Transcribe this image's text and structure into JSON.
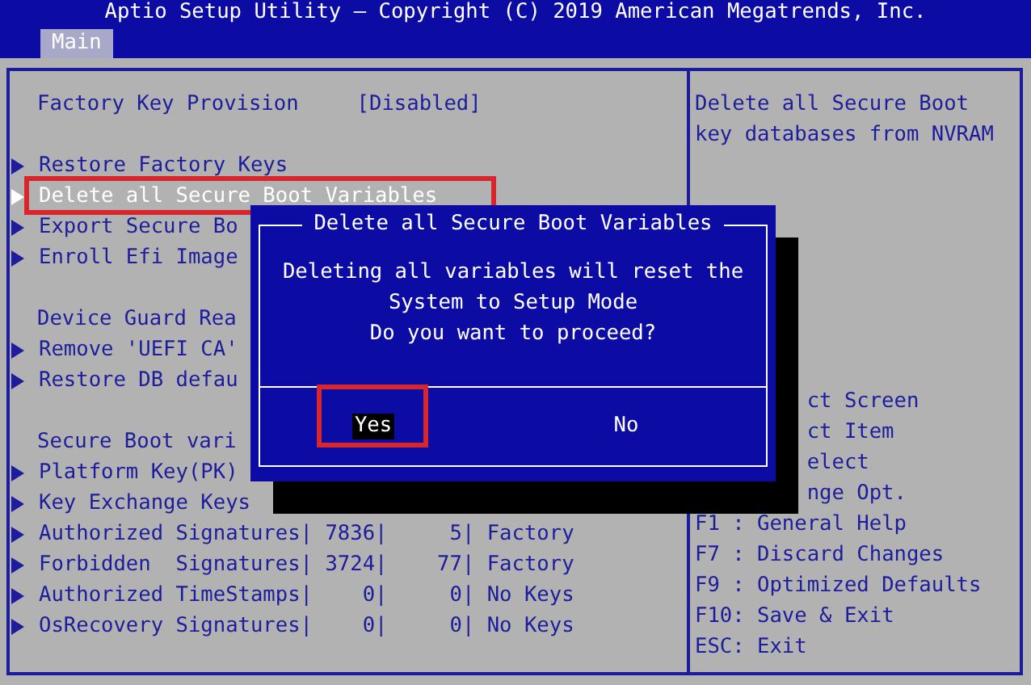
{
  "window": {
    "title": "Aptio Setup Utility – Copyright (C) 2019 American Megatrends, Inc."
  },
  "tabs": [
    {
      "label": "Main",
      "selected": true
    }
  ],
  "settings": [
    {
      "kind": "option",
      "label": "Factory Key Provision",
      "value": "[Disabled]"
    },
    {
      "kind": "blank"
    },
    {
      "kind": "submenu",
      "label": "Restore Factory Keys",
      "selected": false,
      "annotated": false
    },
    {
      "kind": "submenu",
      "label": "Delete all Secure Boot Variables",
      "selected": true,
      "annotated": true
    },
    {
      "kind": "submenu",
      "label": "Export Secure Bo",
      "selected": false,
      "annotated": false
    },
    {
      "kind": "submenu",
      "label": "Enroll Efi Image",
      "selected": false,
      "annotated": false
    },
    {
      "kind": "blank"
    },
    {
      "kind": "heading",
      "label": "Device Guard Rea"
    },
    {
      "kind": "submenu",
      "label": "Remove 'UEFI CA'",
      "selected": false,
      "annotated": false
    },
    {
      "kind": "submenu",
      "label": "Restore DB defau",
      "selected": false,
      "annotated": false
    },
    {
      "kind": "blank"
    },
    {
      "kind": "heading",
      "label": "Secure Boot vari"
    },
    {
      "kind": "submenu",
      "label": "Platform Key(PK)",
      "selected": false,
      "annotated": false
    },
    {
      "kind": "submenu",
      "label": "Key Exchange Keys",
      "selected": false,
      "annotated": false
    },
    {
      "kind": "submenu",
      "label": "Authorized Signatures| 7836|     5| Factory",
      "selected": false,
      "annotated": false
    },
    {
      "kind": "submenu",
      "label": "Forbidden  Signatures| 3724|    77| Factory",
      "selected": false,
      "annotated": false
    },
    {
      "kind": "submenu",
      "label": "Authorized TimeStamps|    0|     0| No Keys",
      "selected": false,
      "annotated": false
    },
    {
      "kind": "submenu",
      "label": "OsRecovery Signatures|    0|     0| No Keys",
      "selected": false,
      "annotated": false
    }
  ],
  "help": [
    "Delete all Secure Boot",
    "key databases from NVRAM"
  ],
  "key_help": [
    {
      "kind": "partial",
      "text": "ct Screen"
    },
    {
      "kind": "partial",
      "text": "ct Item"
    },
    {
      "kind": "partial",
      "text": "elect"
    },
    {
      "kind": "partial",
      "text": "nge Opt."
    },
    {
      "kind": "full",
      "text": "F1 : General Help"
    },
    {
      "kind": "full",
      "text": "F7 : Discard Changes"
    },
    {
      "kind": "full",
      "text": "F9 : Optimized Defaults"
    },
    {
      "kind": "full",
      "text": "F10: Save & Exit"
    },
    {
      "kind": "full",
      "text": "ESC: Exit"
    }
  ],
  "dialog": {
    "title": "Delete all Secure Boot Variables",
    "message": [
      "Deleting all variables will reset the",
      "System to Setup Mode",
      "Do you want to proceed?"
    ],
    "buttons": [
      {
        "label": "Yes",
        "selected": true,
        "annotated": true
      },
      {
        "label": "No",
        "selected": false,
        "annotated": false
      }
    ]
  }
}
